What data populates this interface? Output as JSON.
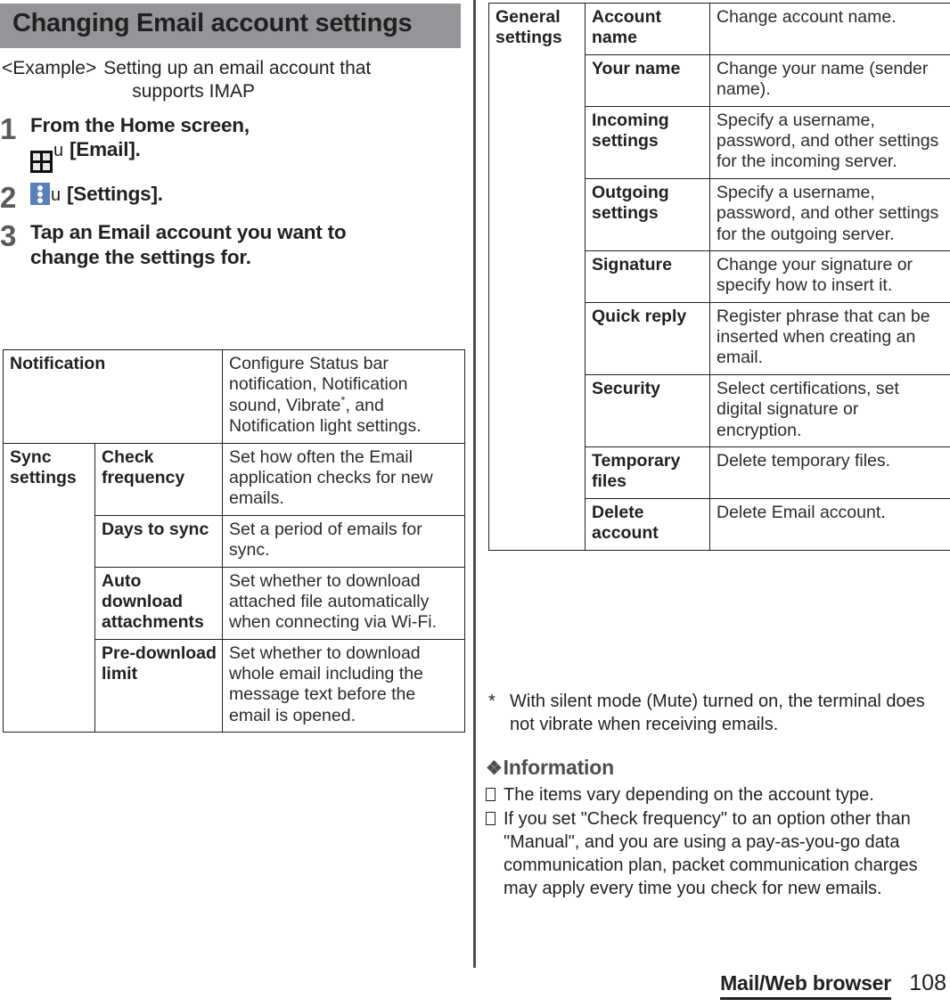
{
  "document": {
    "chapter_heading": "Changing Email account settings",
    "example": {
      "label": "<Example>",
      "line1": "Setting up an email account that",
      "line2": "supports IMAP"
    },
    "steps": [
      {
        "number": "1",
        "line1": "From the Home screen,",
        "icon": "app-drawer-icon",
        "key": "u",
        "line2_after_icon": "[Email]."
      },
      {
        "number": "2",
        "line1": "",
        "icon": "overflow-menu-icon",
        "key": "u",
        "line2_after_icon": "[Settings]."
      },
      {
        "number": "3",
        "line1": "Tap an Email account you want to",
        "line2": "change the settings for."
      }
    ],
    "table_left": {
      "rows": [
        {
          "group": "Notification",
          "group_rowspan": 1,
          "group_colspan": 2,
          "item": "",
          "description": "Configure Status bar notification, Notification sound, Vibrate*, and Notification light settings."
        },
        {
          "group": "Sync settings",
          "group_rowspan": 4,
          "item": "Check frequency",
          "description": "Set how often the Email application checks for new emails."
        },
        {
          "item": "Days to sync",
          "description": "Set a period of emails for sync."
        },
        {
          "item": "Auto download attachments",
          "description": "Set whether to download attached file automatically when connecting via Wi-Fi."
        },
        {
          "item": "Pre-download limit",
          "description": "Set whether to download whole email including the message text before the email is opened."
        }
      ]
    },
    "table_right": {
      "group": "General settings",
      "rows": [
        {
          "item": "Account name",
          "description": "Change account name."
        },
        {
          "item": "Your name",
          "description": "Change your name (sender name)."
        },
        {
          "item": "Incoming settings",
          "description": "Specify a username, password, and other settings for the incoming server."
        },
        {
          "item": "Outgoing settings",
          "description": "Specify a username, password, and other settings for the outgoing server."
        },
        {
          "item": "Signature",
          "description": "Change your signature or specify how to insert it."
        },
        {
          "item": "Quick reply",
          "description": "Register phrase that can be inserted when creating an email."
        },
        {
          "item": "Security",
          "description": "Select certifications, set digital signature or encryption."
        },
        {
          "item": "Temporary files",
          "description": "Delete temporary files."
        },
        {
          "item": "Delete account",
          "description": "Delete Email account."
        }
      ]
    },
    "footnote": {
      "mark": "*",
      "text": "With silent mode (Mute) turned on, the terminal does not vibrate when receiving emails."
    },
    "information": {
      "heading": "Information",
      "heading_symbol": "❖",
      "items": [
        "The items vary depending on the account type.",
        "If you set \"Check frequency\" to an option other than \"Manual\", and you are using a pay-as-you-go data communication plan, packet communication charges may apply every time you check for new emails."
      ]
    },
    "footer": {
      "section_title": "Mail/Web browser",
      "page_number": "108"
    },
    "colors": {
      "banner_gray": "#939598",
      "overflow_icon_blue": "#5681c0",
      "divider_gray": "#4d4d4f",
      "text": "#231f20"
    }
  }
}
